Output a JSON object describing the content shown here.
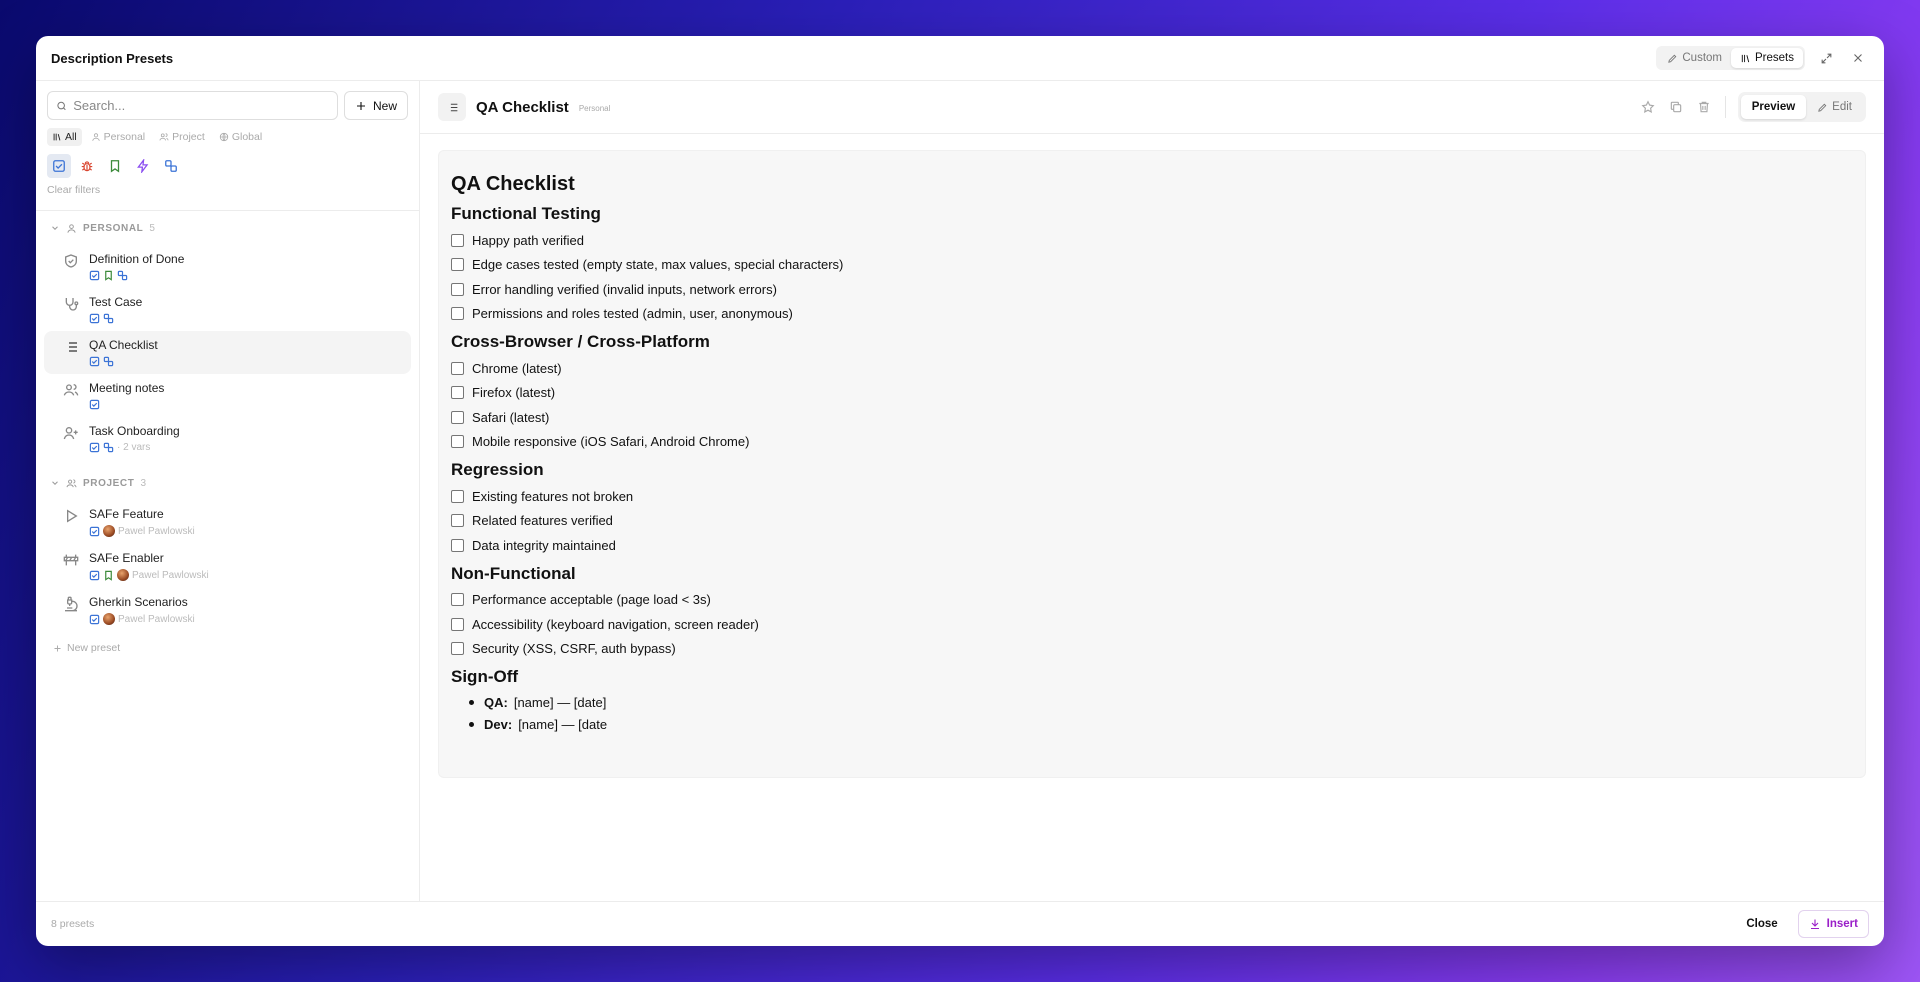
{
  "modal": {
    "title": "Description Presets"
  },
  "header": {
    "custom_label": "Custom",
    "presets_label": "Presets"
  },
  "sidebar": {
    "search_placeholder": "Search...",
    "new_label": "New",
    "scopes": [
      "All",
      "Personal",
      "Project",
      "Global"
    ],
    "clear_filters": "Clear filters",
    "groups": [
      {
        "label": "PERSONAL",
        "count": "5",
        "items": [
          {
            "title": "Definition of Done",
            "icon": "shield-check-icon"
          },
          {
            "title": "Test Case",
            "icon": "stethoscope-icon"
          },
          {
            "title": "QA Checklist",
            "icon": "list-icon",
            "active": true
          },
          {
            "title": "Meeting notes",
            "icon": "users-icon"
          },
          {
            "title": "Task Onboarding",
            "icon": "user-plus-icon",
            "vars": "· 2 vars"
          }
        ]
      },
      {
        "label": "PROJECT",
        "count": "3",
        "items": [
          {
            "title": "SAFe Feature",
            "icon": "play-icon",
            "author": "Pawel Pawlowski"
          },
          {
            "title": "SAFe Enabler",
            "icon": "road-barrier-icon",
            "author": "Pawel Pawlowski"
          },
          {
            "title": "Gherkin Scenarios",
            "icon": "microscope-icon",
            "author": "Pawel Pawlowski"
          }
        ]
      }
    ],
    "new_preset": "New preset"
  },
  "main": {
    "doc_title": "QA Checklist",
    "scope_badge": "Personal",
    "preview_label": "Preview",
    "edit_label": "Edit",
    "content": {
      "h1": "QA Checklist",
      "sections": [
        {
          "heading": "Functional Testing",
          "items": [
            "Happy path verified",
            "Edge cases tested (empty state, max values, special characters)",
            "Error handling verified (invalid inputs, network errors)",
            "Permissions and roles tested (admin, user, anonymous)"
          ]
        },
        {
          "heading": "Cross-Browser / Cross-Platform",
          "items": [
            "Chrome (latest)",
            "Firefox (latest)",
            "Safari (latest)",
            "Mobile responsive (iOS Safari, Android Chrome)"
          ]
        },
        {
          "heading": "Regression",
          "items": [
            "Existing features not broken",
            "Related features verified",
            "Data integrity maintained"
          ]
        },
        {
          "heading": "Non-Functional",
          "items": [
            "Performance acceptable (page load < 3s)",
            "Accessibility (keyboard navigation, screen reader)",
            "Security (XSS, CSRF, auth bypass)"
          ]
        }
      ],
      "signoff": {
        "heading": "Sign-Off",
        "qa_label": "QA:",
        "qa_value": "[name] — [date]",
        "dev_label": "Dev:",
        "dev_value": "[name] — [date"
      }
    }
  },
  "footer": {
    "count": "8 presets",
    "close_label": "Close",
    "insert_label": "Insert"
  },
  "colors": {
    "accent": "#9a1fc8",
    "check_blue": "#3b73d6",
    "bug_red": "#d9452f",
    "bookmark_green": "#3c8a3a",
    "bolt_purple": "#8b4ef0"
  }
}
